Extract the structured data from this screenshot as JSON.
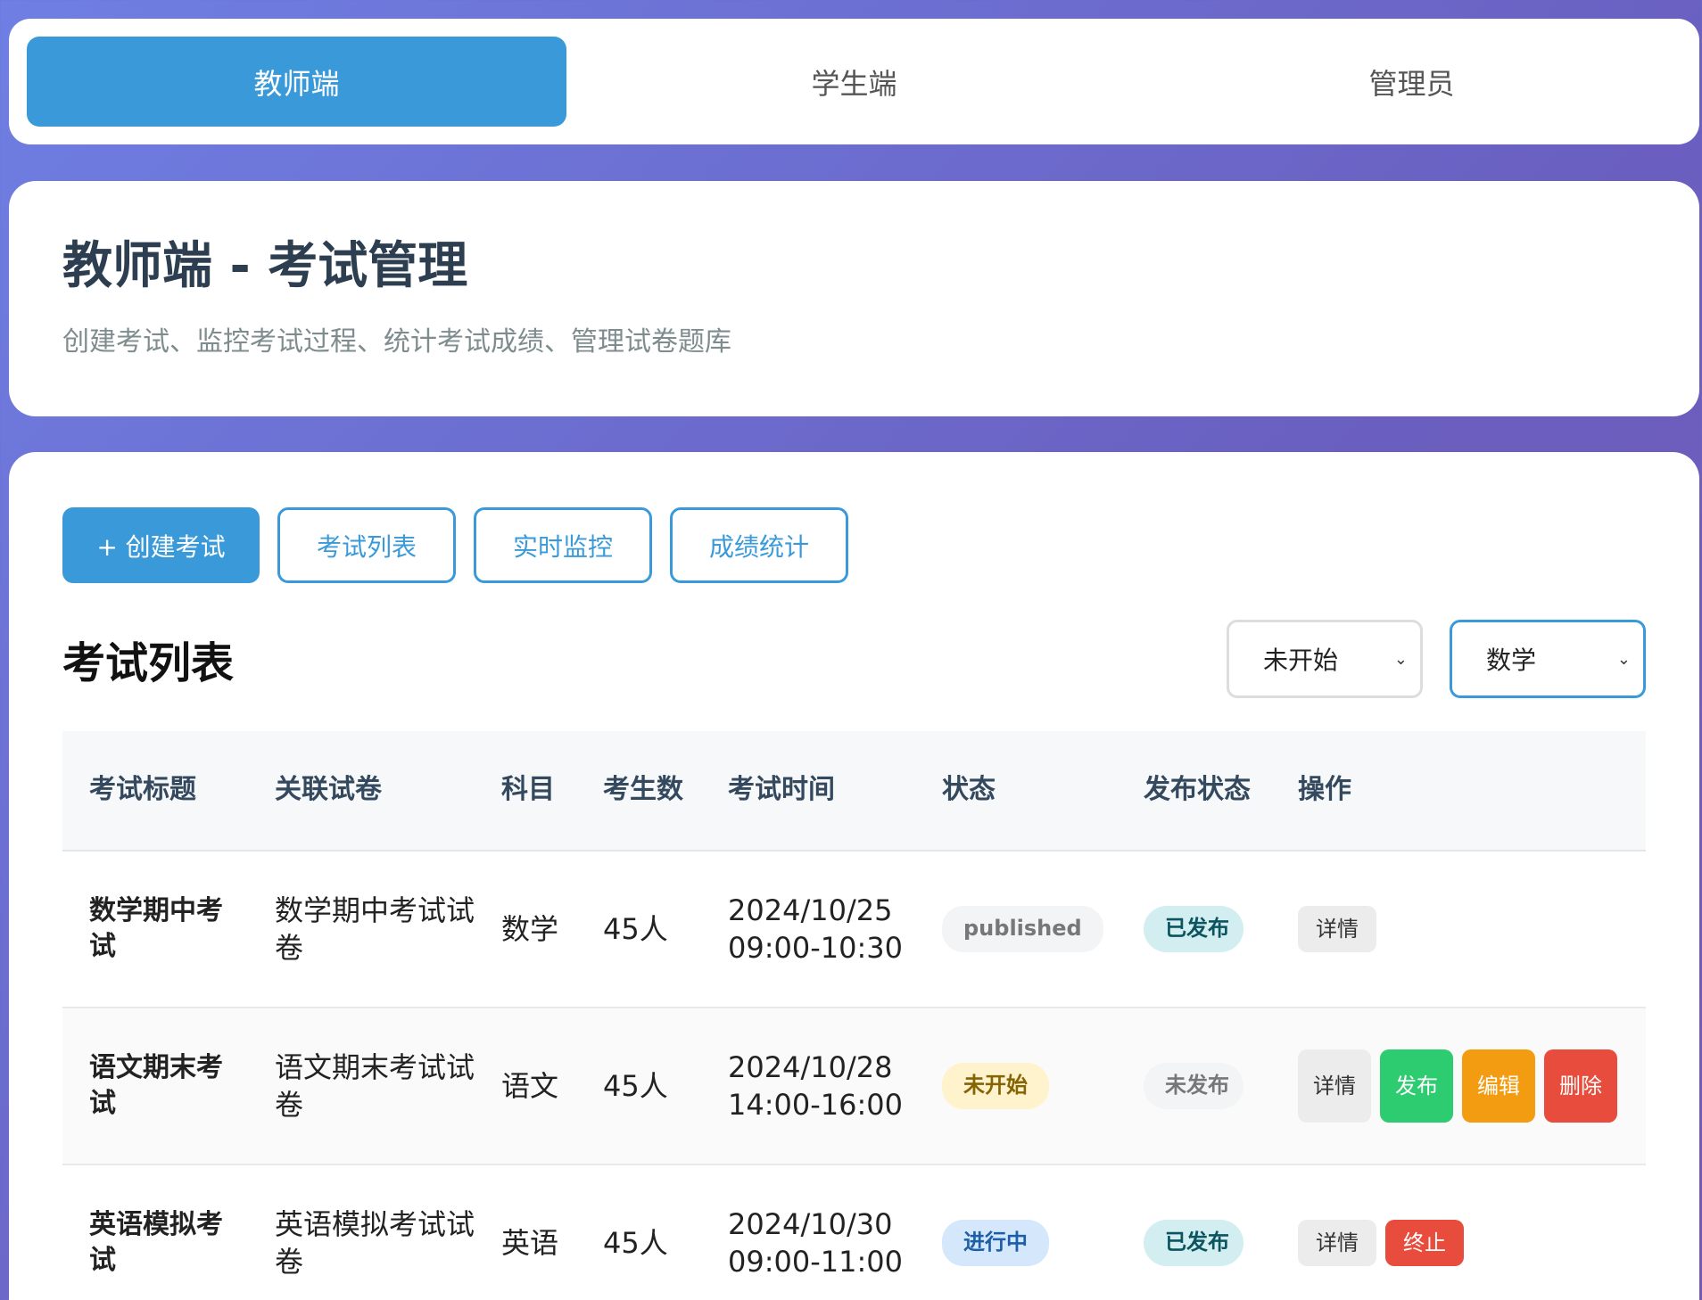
{
  "roles": [
    "教师端",
    "学生端",
    "管理员"
  ],
  "header": {
    "title": "教师端 - 考试管理",
    "subtitle": "创建考试、监控考试过程、统计考试成绩、管理试卷题库"
  },
  "actions": {
    "create": "+ 创建考试",
    "list": "考试列表",
    "monitor": "实时监控",
    "stats": "成绩统计"
  },
  "list": {
    "title": "考试列表",
    "status_filter": "未开始",
    "subject_filter": "数学"
  },
  "table": {
    "headers": {
      "title": "考试标题",
      "paper": "关联试卷",
      "subject": "科目",
      "count": "考生数",
      "time": "考试时间",
      "status": "状态",
      "publish": "发布状态",
      "ops": "操作"
    },
    "rows": [
      {
        "title": "数学期中考试",
        "paper": "数学期中考试试卷",
        "subject": "数学",
        "count": "45人",
        "time": "2024/10/25 09:00-10:30",
        "status": "published",
        "publish": "已发布",
        "ops": [
          "详情"
        ]
      },
      {
        "title": "语文期末考试",
        "paper": "语文期末考试试卷",
        "subject": "语文",
        "count": "45人",
        "time": "2024/10/28 14:00-16:00",
        "status": "未开始",
        "publish": "未发布",
        "ops": [
          "详情",
          "发布",
          "编辑",
          "删除"
        ]
      },
      {
        "title": "英语模拟考试",
        "paper": "英语模拟考试试卷",
        "subject": "英语",
        "count": "45人",
        "time": "2024/10/30 09:00-11:00",
        "status": "进行中",
        "publish": "已发布",
        "ops": [
          "详情",
          "终止"
        ]
      }
    ]
  },
  "colors": {
    "accent": "#3a9ad9",
    "title": "#2c3e50",
    "success": "#2ecc71",
    "warning": "#f39c12",
    "danger": "#e74c3c"
  }
}
